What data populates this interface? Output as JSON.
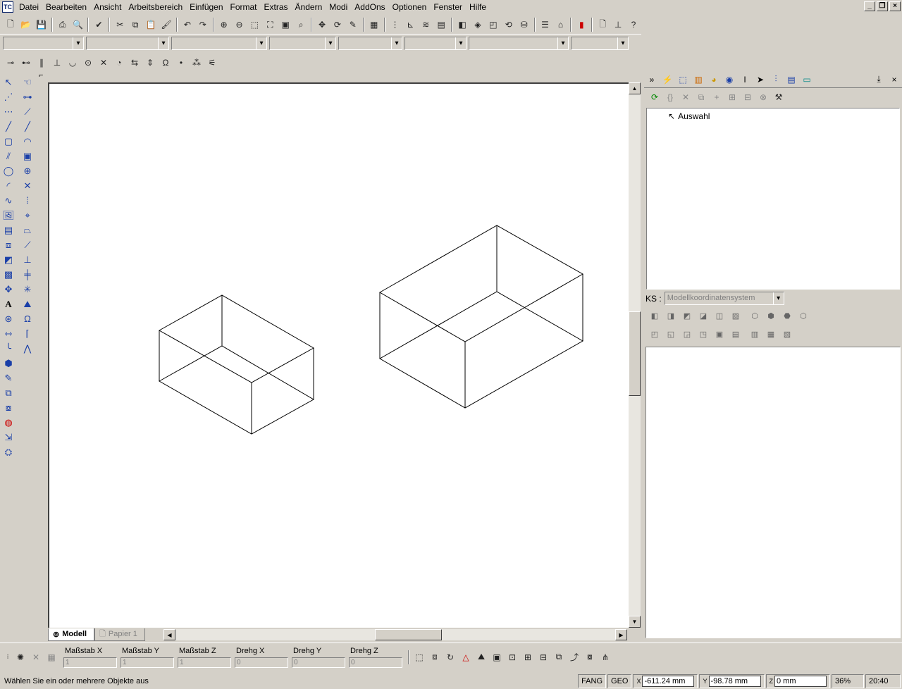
{
  "menu": [
    "Datei",
    "Bearbeiten",
    "Ansicht",
    "Arbeitsbereich",
    "Einfügen",
    "Format",
    "Extras",
    "Ändern",
    "Modi",
    "AddOns",
    "Optionen",
    "Fenster",
    "Hilfe"
  ],
  "app_logo": "TC",
  "tabs": {
    "model": "Modell",
    "paper": "Papier 1"
  },
  "tree": {
    "root": "Auswahl"
  },
  "ks": {
    "label": "KS :",
    "value": "Modellkoordinatensystem"
  },
  "transform_fields": [
    {
      "label": "Maßstab X",
      "value": "1"
    },
    {
      "label": "Maßstab Y",
      "value": "1"
    },
    {
      "label": "Maßstab Z",
      "value": "1"
    },
    {
      "label": "Drehg X",
      "value": "0"
    },
    {
      "label": "Drehg Y",
      "value": "0"
    },
    {
      "label": "Drehg Z",
      "value": "0"
    }
  ],
  "status": {
    "message": "Wählen Sie ein oder mehrere Objekte aus",
    "fang": "FANG",
    "geo": "GEO",
    "x": "-611.24 mm",
    "y": "-98.78 mm",
    "z": "0 mm",
    "zoom": "36%",
    "time": "20:40"
  },
  "colors": {
    "background": "#d4d0c8",
    "canvas": "#ffffff",
    "accent": "#1a3fa8"
  }
}
